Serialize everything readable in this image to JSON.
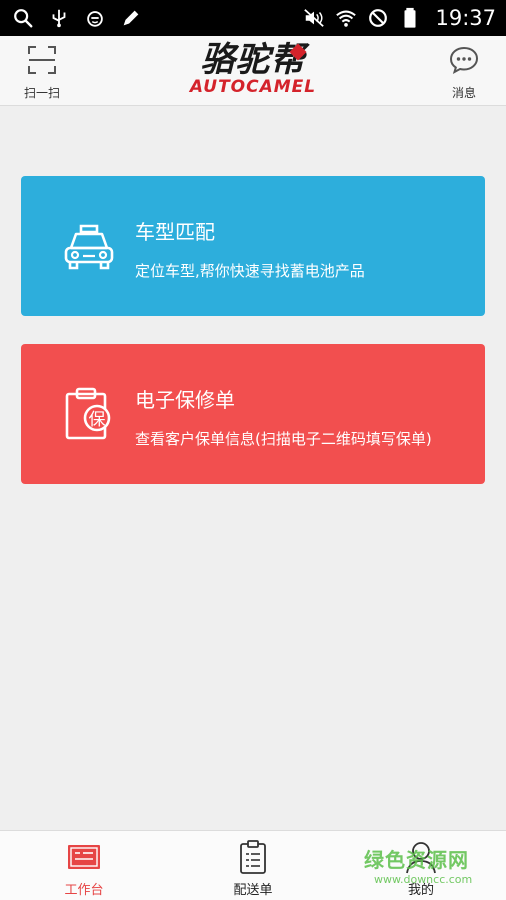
{
  "status_bar": {
    "time": "19:37",
    "left_icons": [
      "search-icon",
      "usb-icon",
      "emoji-icon",
      "pencil-icon"
    ],
    "right_icons": [
      "mute-icon",
      "wifi-icon",
      "no-disturb-icon",
      "battery-icon"
    ]
  },
  "header": {
    "scan_label": "扫一扫",
    "message_label": "消息",
    "logo_cn": "骆驼帮",
    "logo_en": "AUTOCAMEL"
  },
  "cards": [
    {
      "title": "车型匹配",
      "desc": "定位车型,帮你快速寻找蓄电池产品",
      "color": "#2daedc",
      "icon": "car-icon"
    },
    {
      "title": "电子保修单",
      "desc": "查看客户保单信息(扫描电子二维码填写保单)",
      "color": "#f24f4f",
      "icon": "warranty-icon",
      "icon_text": "保"
    }
  ],
  "bottom_nav": {
    "items": [
      {
        "label": "工作台",
        "icon": "workbench-icon",
        "active": true
      },
      {
        "label": "配送单",
        "icon": "delivery-list-icon",
        "active": false
      },
      {
        "label": "我的",
        "icon": "profile-icon",
        "active": false
      }
    ],
    "active_color": "#e64545"
  },
  "watermark": {
    "cn": "绿色资源网",
    "url": "www.downcc.com"
  }
}
